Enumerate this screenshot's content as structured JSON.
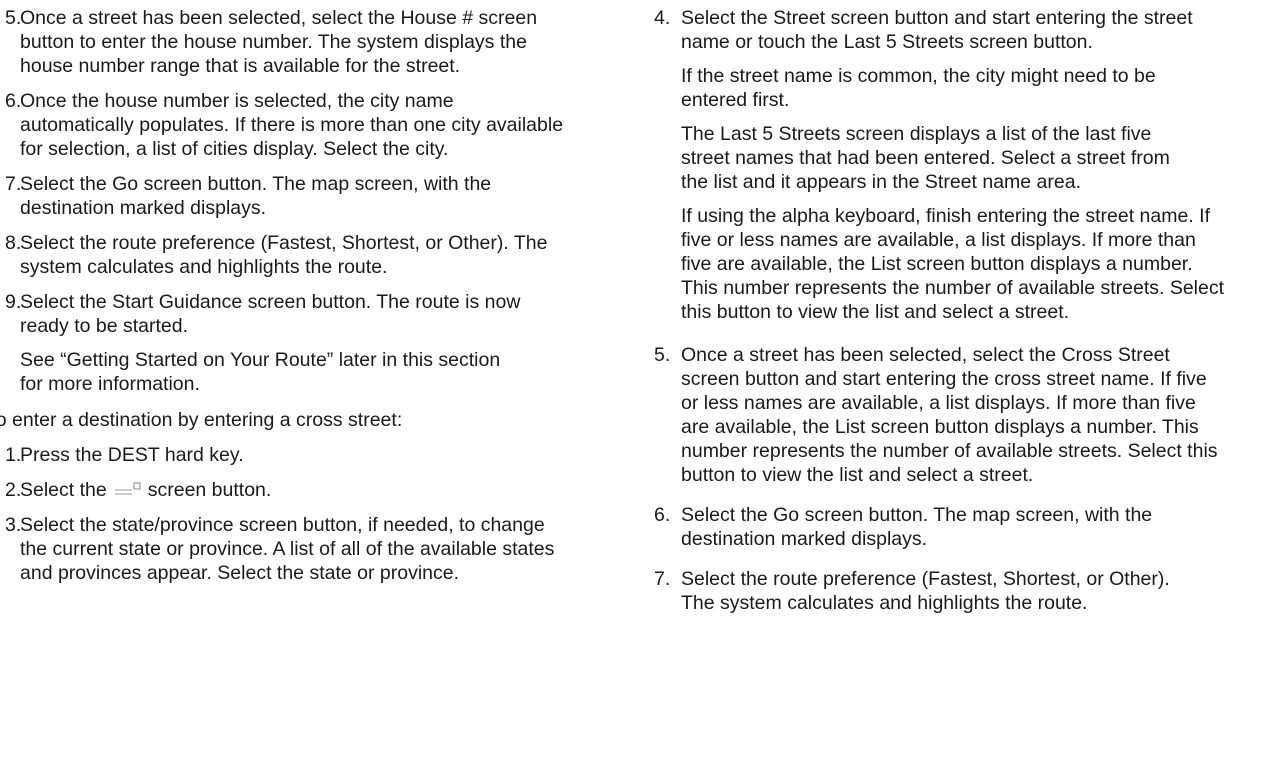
{
  "left_column": {
    "steps_a": [
      {
        "num": "5.",
        "text": "Once a street has been selected, select the House # screen button to enter the house number. The system displays the house number range that is available for the street."
      },
      {
        "num": "6.",
        "text": "Once the house number is selected, the city name automatically populates. If there is more than one city available for selection, a list of cities display. Select the city."
      },
      {
        "num": "7.",
        "text": "Select the Go screen button. The map screen, with the destination marked displays."
      },
      {
        "num": "8.",
        "text": "Select the route preference (Fastest, Shortest, or Other). The system calculates and highlights the route."
      },
      {
        "num": "9.",
        "text": "Select the Start Guidance screen button. The route is now ready to be started.",
        "note": "See “Getting Started on Your Route” later in this section for more information."
      }
    ],
    "intro": "To enter a destination by entering a cross street:",
    "steps_b": [
      {
        "num": "1.",
        "text": "Press the DEST hard key."
      },
      {
        "num": "2.",
        "text_before": "Select the",
        "icon": "cross-street-button-icon",
        "text_after": "screen button."
      },
      {
        "num": "3.",
        "text": "Select the state/province screen button, if needed, to change the current state or province. A list of all of the available states and provinces appear. Select the state or province."
      }
    ]
  },
  "right_column": {
    "steps": [
      {
        "num": "4.",
        "paras": [
          "Select the Street screen button and start entering the street name or touch the Last 5 Streets screen button.",
          "If the street name is common, the city might need to be entered first.",
          "The Last 5 Streets screen displays a list of the last five street names that had been entered. Select a street from the list and it appears in the Street name area.",
          "If using the alpha keyboard, finish entering the street name. If five or less names are available, a list displays. If more than five are available, the List screen button displays a number. This number represents the number of available streets. Select this button to view the list and select a street."
        ]
      },
      {
        "num": "5.",
        "paras": [
          "Once a street has been selected, select the Cross Street screen button and start entering the cross street name. If five or less names are available, a list displays. If more than five are available, the List screen button displays a number. This number represents the number of available streets. Select this button to view the list and select a street."
        ]
      },
      {
        "num": "6.",
        "paras": [
          "Select the Go screen button. The map screen, with the destination marked displays."
        ]
      },
      {
        "num": "7.",
        "paras": [
          "Select the route preference (Fastest, Shortest, or Other). The system calculates and highlights the route."
        ]
      }
    ]
  }
}
